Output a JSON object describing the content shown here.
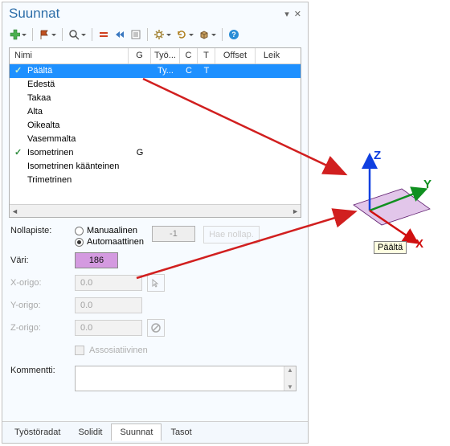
{
  "panel": {
    "title": "Suunnat"
  },
  "toolbar": {
    "add_icon": "add-icon",
    "flag_icon": "flag-icon",
    "search_icon": "search-icon",
    "equals_icon": "equals-icon",
    "rewind_icon": "rewind-icon",
    "list_icon": "list-icon",
    "gear_icon": "gear-icon",
    "refresh_icon": "refresh-icon",
    "box_icon": "box-icon",
    "help_icon": "help-icon"
  },
  "grid": {
    "headers": {
      "name": "Nimi",
      "g": "G",
      "tyo": "Työ...",
      "c": "C",
      "t": "T",
      "offset": "Offset",
      "leik": "Leik"
    },
    "rows": [
      {
        "name": "Päältä",
        "checked": true,
        "selected": true,
        "g": "",
        "tyo": "Ty...",
        "c": "C",
        "t": "T"
      },
      {
        "name": "Edestä",
        "checked": false,
        "selected": false,
        "g": "",
        "tyo": "",
        "c": "",
        "t": ""
      },
      {
        "name": "Takaa",
        "checked": false,
        "selected": false,
        "g": "",
        "tyo": "",
        "c": "",
        "t": ""
      },
      {
        "name": "Alta",
        "checked": false,
        "selected": false,
        "g": "",
        "tyo": "",
        "c": "",
        "t": ""
      },
      {
        "name": "Oikealta",
        "checked": false,
        "selected": false,
        "g": "",
        "tyo": "",
        "c": "",
        "t": ""
      },
      {
        "name": "Vasemmalta",
        "checked": false,
        "selected": false,
        "g": "",
        "tyo": "",
        "c": "",
        "t": ""
      },
      {
        "name": "Isometrinen",
        "checked": true,
        "selected": false,
        "g": "G",
        "tyo": "",
        "c": "",
        "t": ""
      },
      {
        "name": "Isometrinen käänteinen",
        "checked": false,
        "selected": false,
        "g": "",
        "tyo": "",
        "c": "",
        "t": ""
      },
      {
        "name": "Trimetrinen",
        "checked": false,
        "selected": false,
        "g": "",
        "tyo": "",
        "c": "",
        "t": ""
      }
    ]
  },
  "form": {
    "nollapiste_label": "Nollapiste:",
    "manual_label": "Manuaalinen",
    "auto_label": "Automaattinen",
    "neg1": "-1",
    "ghost_btn": "Hae nollap.",
    "vari_label": "Väri:",
    "vari_value": "186",
    "vari_hex": "#d49ae0",
    "xorigo_label": "X-origo:",
    "yorigo_label": "Y-origo:",
    "zorigo_label": "Z-origo:",
    "zero_val": "0.0",
    "assoc_label": "Assosiatiivinen",
    "kommentti_label": "Kommentti:"
  },
  "tabs": {
    "items": [
      "Työstöradat",
      "Solidit",
      "Suunnat",
      "Tasot"
    ],
    "active_index": 2
  },
  "viewport": {
    "axes": {
      "x": "X",
      "y": "Y",
      "z": "Z"
    },
    "tooltip": "Päältä",
    "face_hex": "#e2c6ea"
  },
  "colors": {
    "accent": "#1e90ff",
    "arrow": "#d11f1f"
  }
}
